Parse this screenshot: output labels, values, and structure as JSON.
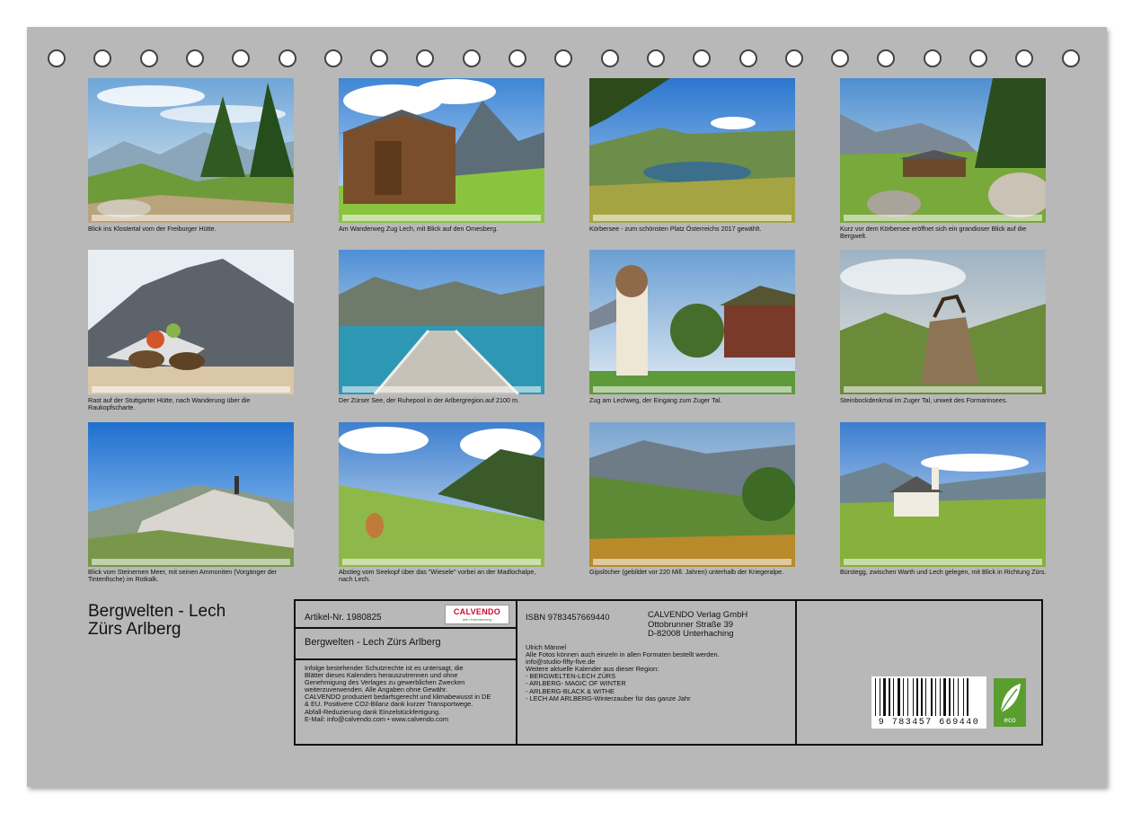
{
  "photos": [
    {
      "caption": "Blick ins Klostertal vom der Freiburger Hütte."
    },
    {
      "caption": "Am Wanderweg Zug Lech, mit Blick auf den Omesberg."
    },
    {
      "caption": "Körbersee - zum schönsten Platz Österreichs 2017 gewählt."
    },
    {
      "caption": "Kurz vor dem Körbersee eröffnet sich ein grandioser Blick auf  die Bergwelt."
    },
    {
      "caption": "Rast auf der Stuttgarter Hütte, nach Wanderung über die Raukopfscharte."
    },
    {
      "caption": "Der Zürser See, der Ruhepool in der Arlbergregion.auf 2100 m."
    },
    {
      "caption": "Zug am Lechweg, der Eingang zum Zuger Tal."
    },
    {
      "caption": "Steinbockdenkmal im Zuger Tal, unweit des Formarinsees."
    },
    {
      "caption": "Blick vom Steinernen Meer, mit seinen Ammoniten (Vorgänger der Tintenfische) im Rotkalk."
    },
    {
      "caption": "Abstieg vom Seekopf über das \"Wiesele\" vorbei an der Madlochalpe, nach Lech."
    },
    {
      "caption": "Gipslöcher (gebildet vor 220 Mill. Jahren) unterhalb der Kriegeralpe."
    },
    {
      "caption": "Bürstegg, zwischen Warth und Lech gelegen, mit Blick in Richtung Zürs."
    }
  ],
  "title": {
    "line1": "Bergwelten - Lech",
    "line2": "Zürs Arlberg"
  },
  "info": {
    "article": "Artikel-Nr. 1980825",
    "logo_text": "CALVENDO",
    "logo_sub": "dein Kalenderweg",
    "product_title": "Bergwelten - Lech Zürs Arlberg",
    "legal": [
      "Infolge bestehender Schutzrechte ist es untersagt, die",
      "Blätter dieses Kalenders herauszutrennen und ohne",
      "Genehmigung des Verlages zu gewerblichen Zwecken",
      "weiterzuverwenden. Alle Angaben ohne Gewähr.",
      "CALVENDO produziert bedarfsgerecht und klimabewusst in DE",
      "& EU. Positivere CO2-Bilanz dank kurzer Transportwege.",
      "Abfall-Reduzierung dank Einzelstückfertigung.",
      "E-Mail: info@calvendo.com • www.calvendo.com"
    ],
    "isbn": "ISBN 9783457669440",
    "publisher": [
      "CALVENDO Verlag GmbH",
      "Ottobrunner Straße 39",
      "D-82008 Unterhaching"
    ],
    "author": [
      "Ulrich Männel",
      "Alle Fotos können auch einzeln in allen Formaten bestellt werden.",
      "info@studio-fifty-five.de",
      "Weitere aktuelle Kalender aus dieser Region:",
      "- BERGWELTEN-LECH ZÜRS",
      "- ARLBERG- MAGIC OF WINTER",
      "- ARLBERG-BLACK & WITHE",
      "- LECH AM ARLBERG-Winterzauber für das ganze Jahr"
    ],
    "barcode_number": "9 783457 669440",
    "eco_label": "eco"
  }
}
